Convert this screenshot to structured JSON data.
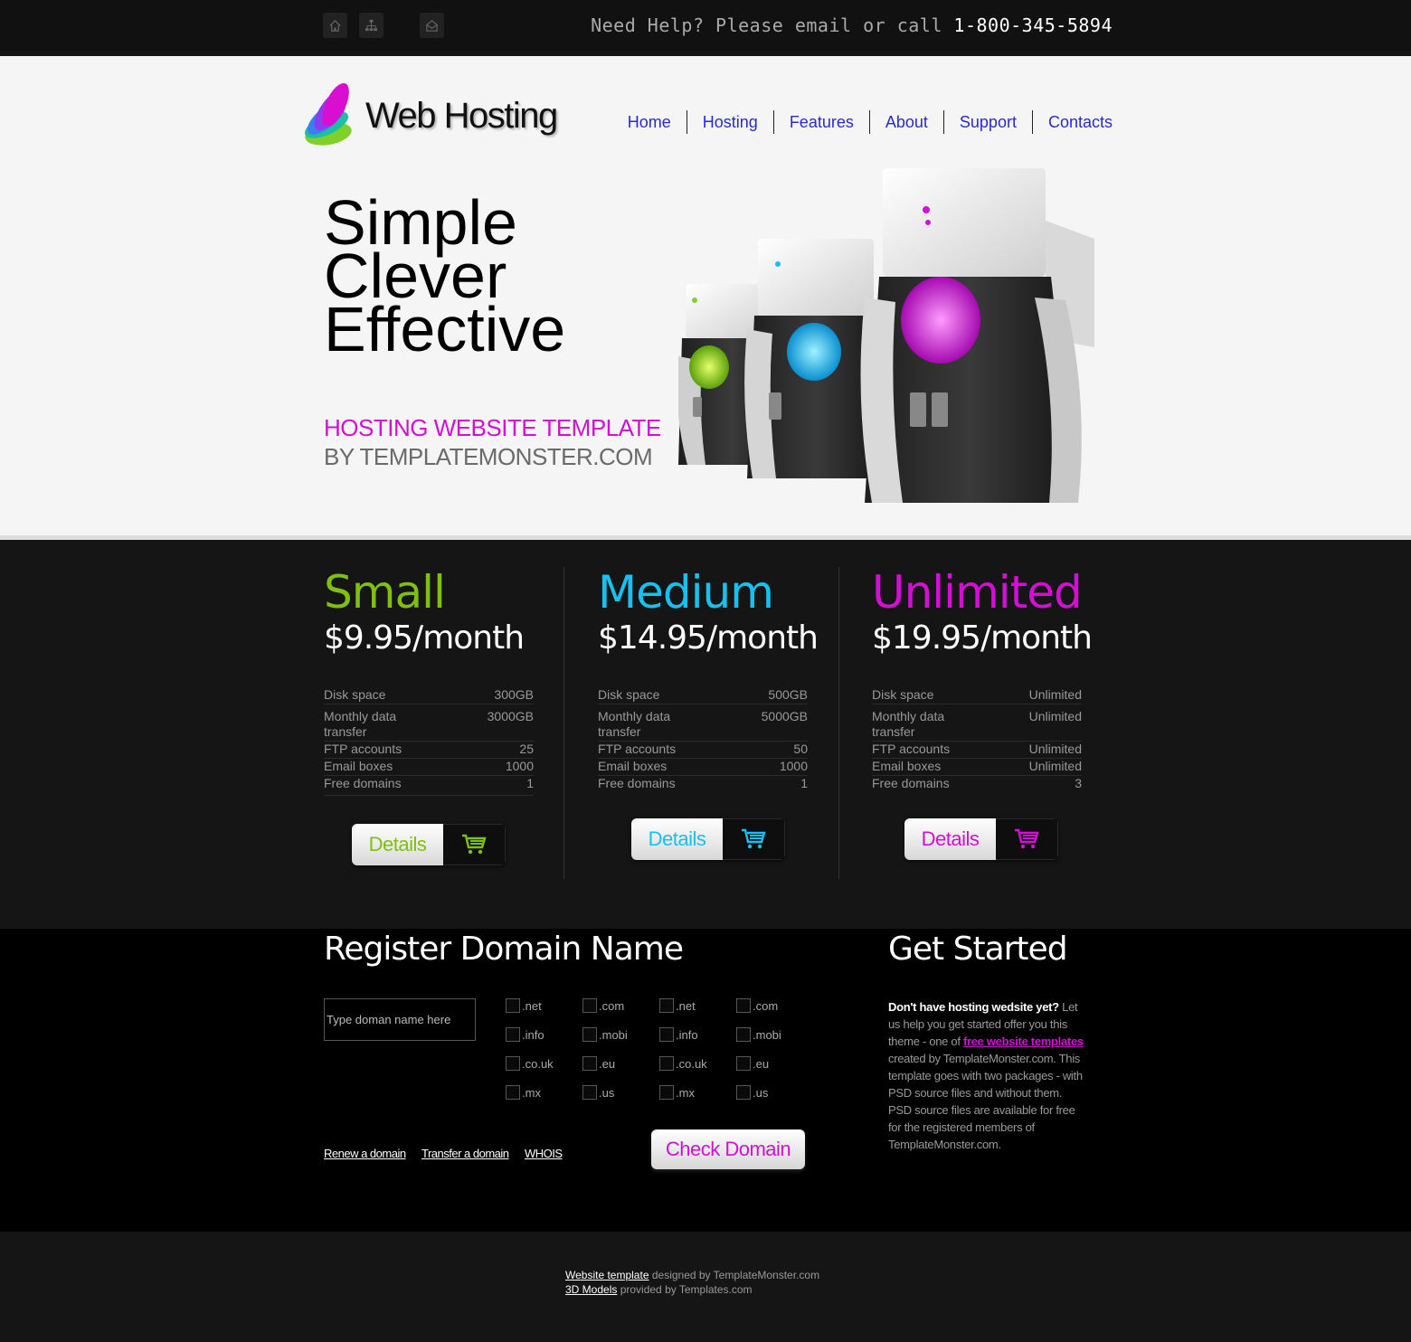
{
  "topbar": {
    "icons": [
      "home-icon",
      "sitemap-icon",
      "mail-icon"
    ],
    "help_text": "Need Help? Please email or call",
    "phone": "1-800-345-5894"
  },
  "header": {
    "logo_text": "Web Hosting",
    "nav": [
      "Home",
      "Hosting",
      "Features",
      "About",
      "Support",
      "Contacts"
    ]
  },
  "hero": {
    "headline": [
      "Simple",
      "Clever",
      "Effective"
    ],
    "tagline1": "HOSTING WEBSITE TEMPLATE",
    "tagline2": "BY TEMPLATEMONSTER.COM",
    "colors": {
      "accent": "#d40fd4"
    }
  },
  "plans": [
    {
      "name": "Small",
      "price": "$9.95/month",
      "color": "#7fbf0f",
      "specs": [
        {
          "label": "Disk space",
          "value": "300GB"
        },
        {
          "label": "Monthly data transfer",
          "value": "3000GB"
        },
        {
          "label": "FTP accounts",
          "value": "25"
        },
        {
          "label": "Email boxes",
          "value": "1000"
        },
        {
          "label": "Free domains",
          "value": "1"
        }
      ],
      "button": "Details"
    },
    {
      "name": "Medium",
      "price": "$14.95/month",
      "color": "#18c0ef",
      "specs": [
        {
          "label": "Disk space",
          "value": "500GB"
        },
        {
          "label": "Monthly data transfer",
          "value": "5000GB"
        },
        {
          "label": "FTP accounts",
          "value": "50"
        },
        {
          "label": "Email boxes",
          "value": "1000"
        },
        {
          "label": "Free domains",
          "value": "1"
        }
      ],
      "button": "Details"
    },
    {
      "name": "Unlimited",
      "price": "$19.95/month",
      "color": "#d40fd4",
      "specs": [
        {
          "label": "Disk space",
          "value": "Unlimited"
        },
        {
          "label": "Monthly data transfer",
          "value": "Unlimited"
        },
        {
          "label": "FTP accounts",
          "value": "Unlimited"
        },
        {
          "label": "Email boxes",
          "value": "Unlimited"
        },
        {
          "label": "Free domains",
          "value": "3"
        }
      ],
      "button": "Details"
    }
  ],
  "domain": {
    "title": "Register Domain Name",
    "placeholder": "Type doman name here",
    "tlds": [
      [
        ".net",
        ".com",
        ".net",
        ".com"
      ],
      [
        ".info",
        ".mobi",
        ".info",
        ".mobi"
      ],
      [
        ".co.uk",
        ".eu",
        ".co.uk",
        ".eu"
      ],
      [
        ".mx",
        ".us",
        ".mx",
        ".us"
      ]
    ],
    "links": [
      "Renew a domain",
      "Transfer a domain",
      "WHOIS"
    ],
    "check_button": "Check Domain"
  },
  "get_started": {
    "title": "Get Started",
    "bold_intro": "Don't have hosting wedsite yet?",
    "text1": "Let us help you get started offer you this theme - one of",
    "link": "free website templates",
    "text2": "created by TemplateMonster.com. This template goes with two packages - with PSD source files and without them. PSD source files are available for free for the registered members of TemplateMonster.com."
  },
  "footer": {
    "line1_link": "Website template",
    "line1_text": "designed by TemplateMonster.com",
    "line2_link": "3D Models",
    "line2_text": "provided by Templates.com"
  }
}
